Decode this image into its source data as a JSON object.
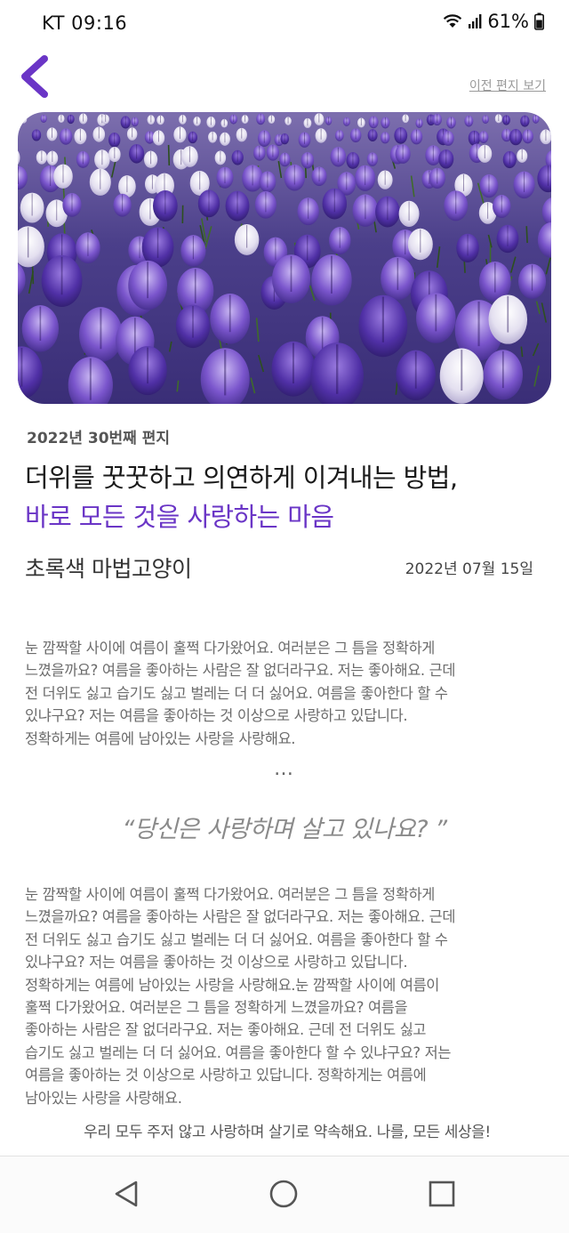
{
  "status": {
    "carrier_time": "KT  09:16",
    "battery": "61%"
  },
  "header": {
    "back_icon": "chevron-left-icon",
    "prev_letters_label": "이전 편지 보기"
  },
  "hero": {
    "image": "purple crocus flower field photo"
  },
  "letter": {
    "issue": "2022년 30번째 편지",
    "title_line1": "더위를 꿋꿋하고 의연하게 이겨내는 방법,",
    "title_line2": "바로 모든 것을  사랑하는 마음",
    "author": "초록색 마법고양이",
    "date": "2022년 07월 15일",
    "para1_lines": [
      "눈 깜짝할 사이에 여름이 훌쩍 다가왔어요. 여러분은 그 틈을 정확하게",
      "느꼈을까요? 여름을 좋아하는 사람은 잘 없더라구요. 저는 좋아해요. 근데",
      "전 더위도 싫고 습기도 싫고 벌레는 더 더 싫어요. 여름을 좋아한다 할 수",
      "있냐구요? 저는 여름을 좋아하는 것 이상으로 사랑하고 있답니다.",
      "정확하게는 여름에 남아있는 사랑을 사랑해요."
    ],
    "ellipsis": "…",
    "quote": "“당신은 사랑하며 살고 있나요? ”",
    "para2_lines": [
      "눈 깜짝할 사이에 여름이 훌쩍 다가왔어요. 여러분은 그 틈을 정확하게",
      "느꼈을까요? 여름을 좋아하는 사람은 잘 없더라구요. 저는 좋아해요. 근데",
      "전 더위도 싫고 습기도 싫고 벌레는 더 더 싫어요. 여름을 좋아한다 할 수",
      "있냐구요? 저는 여름을 좋아하는 것 이상으로 사랑하고 있답니다.",
      "정확하게는 여름에 남아있는 사랑을 사랑해요.눈 깜짝할 사이에 여름이",
      "훌쩍 다가왔어요. 여러분은 그 틈을 정확하게 느꼈을까요? 여름을",
      "좋아하는 사람은 잘 없더라구요. 저는 좋아해요. 근데 전 더위도 싫고",
      "습기도 싫고 벌레는 더 더 싫어요. 여름을 좋아한다 할 수 있냐구요? 저는",
      "여름을 좋아하는 것 이상으로 사랑하고 있답니다. 정확하게는 여름에",
      "남아있는 사랑을 사랑해요."
    ],
    "closing": "우리 모두 주저 않고 사랑하며 살기로 약속해요. 나를, 모든 세상을!"
  },
  "colors": {
    "accent": "#6a35c6",
    "text": "#333333",
    "muted": "#6b6b6b"
  },
  "nav": {
    "back": "triangle-back-icon",
    "home": "circle-home-icon",
    "recent": "square-recent-icon"
  }
}
